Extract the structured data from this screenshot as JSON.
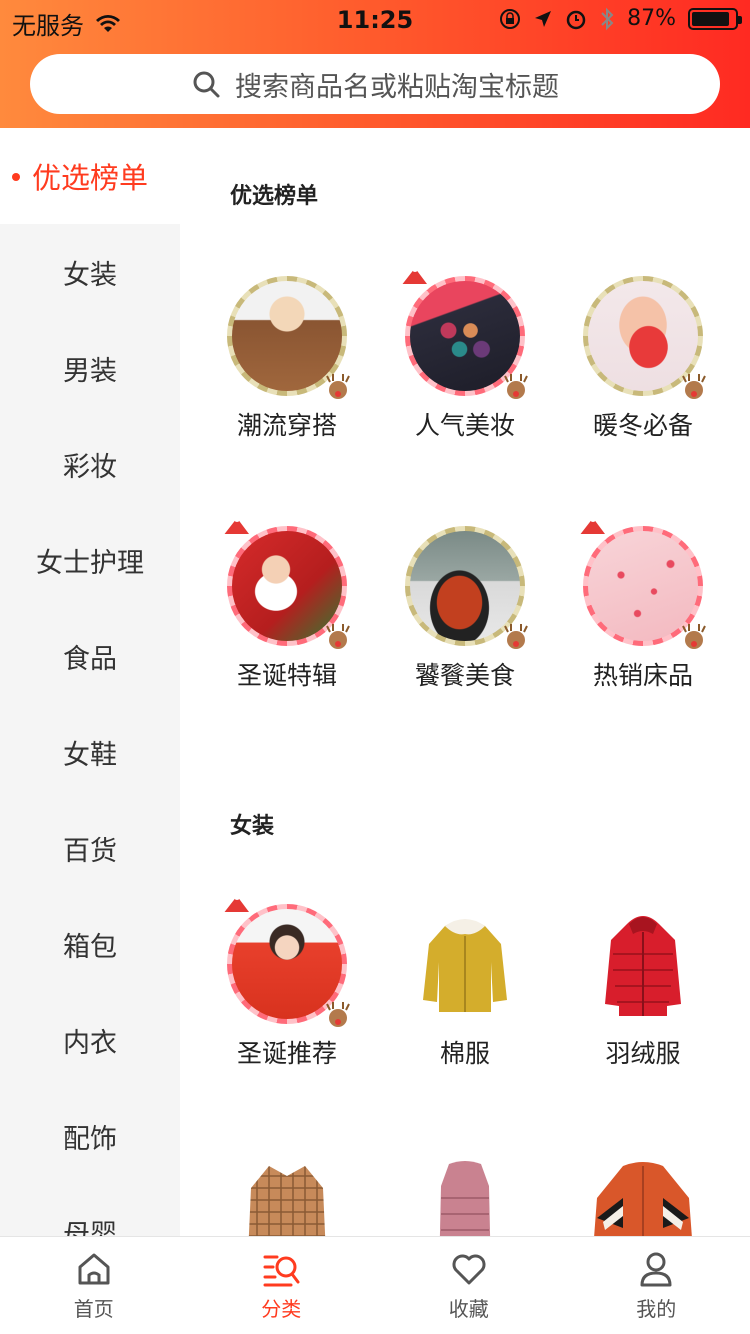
{
  "status": {
    "carrier": "无服务",
    "time": "11:25",
    "battery": "87%",
    "battery_level": 0.87
  },
  "search": {
    "placeholder": "搜索商品名或粘贴淘宝标题"
  },
  "sidebar": {
    "items": [
      {
        "label": "优选榜单",
        "active": true
      },
      {
        "label": "女装"
      },
      {
        "label": "男装"
      },
      {
        "label": "彩妆"
      },
      {
        "label": "女士护理"
      },
      {
        "label": "食品"
      },
      {
        "label": "女鞋"
      },
      {
        "label": "百货"
      },
      {
        "label": "箱包"
      },
      {
        "label": "内衣"
      },
      {
        "label": "配饰"
      },
      {
        "label": "母婴"
      }
    ]
  },
  "sections": [
    {
      "title": "优选榜单",
      "items": [
        {
          "label": "潮流穿搭",
          "icon": "fashion-model-photo"
        },
        {
          "label": "人气美妆",
          "icon": "eyeshadow-palette-photo"
        },
        {
          "label": "暖冬必备",
          "icon": "hand-warmer-photo"
        },
        {
          "label": "圣诞特辑",
          "icon": "santa-doll-photo"
        },
        {
          "label": "饕餮美食",
          "icon": "hotpot-food-photo"
        },
        {
          "label": "热销床品",
          "icon": "bedding-photo"
        }
      ]
    },
    {
      "title": "女装",
      "items": [
        {
          "label": "圣诞推荐",
          "icon": "christmas-hoodie-photo"
        },
        {
          "label": "棉服",
          "icon": "padded-jacket-photo"
        },
        {
          "label": "羽绒服",
          "icon": "down-jacket-photo"
        },
        {
          "label": "",
          "icon": "plaid-coat-photo"
        },
        {
          "label": "",
          "icon": "velvet-vest-photo"
        },
        {
          "label": "",
          "icon": "fleece-jacket-photo"
        }
      ]
    }
  ],
  "tabbar": {
    "tabs": [
      {
        "label": "首页",
        "icon": "home-icon"
      },
      {
        "label": "分类",
        "icon": "category-search-icon",
        "active": true
      },
      {
        "label": "收藏",
        "icon": "heart-icon"
      },
      {
        "label": "我的",
        "icon": "user-icon"
      }
    ]
  },
  "colors": {
    "accent": "#ff3b1f",
    "header_start": "#ff8a3d",
    "header_end": "#ff2a22"
  }
}
